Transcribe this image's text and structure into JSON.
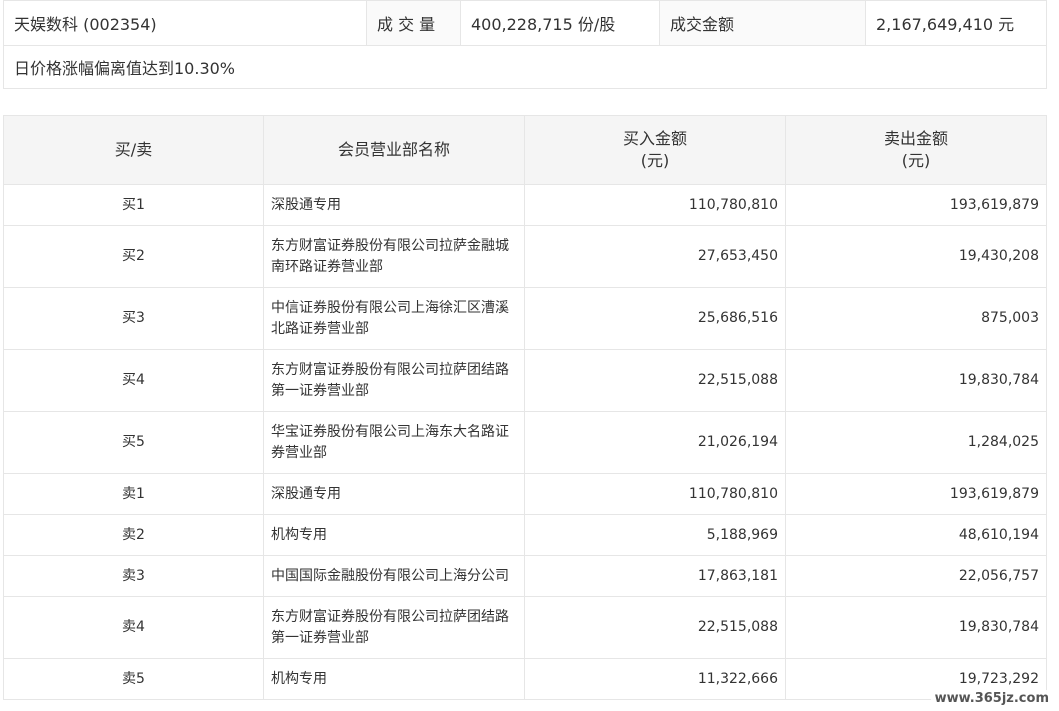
{
  "summary": {
    "stock": "天娱数科 (002354)",
    "volume_label": "成 交 量",
    "volume_value": "400,228,715 份/股",
    "amount_label": "成交金额",
    "amount_value": "2,167,649,410 元",
    "note": "日价格涨幅偏离值达到10.30%"
  },
  "table": {
    "headers": {
      "side": "买/卖",
      "name": "会员营业部名称",
      "buy_line1": "买入金额",
      "buy_line2": "(元)",
      "sell_line1": "卖出金额",
      "sell_line2": "(元)"
    },
    "rows": [
      {
        "side": "买1",
        "name_l1": "深股通专用",
        "name_l2": "",
        "buy": "110,780,810",
        "sell": "193,619,879"
      },
      {
        "side": "买2",
        "name_l1": "东方财富证券股份有限公司拉萨金融城",
        "name_l2": "南环路证券营业部",
        "buy": "27,653,450",
        "sell": "19,430,208"
      },
      {
        "side": "买3",
        "name_l1": "中信证券股份有限公司上海徐汇区漕溪",
        "name_l2": "北路证券营业部",
        "buy": "25,686,516",
        "sell": "875,003"
      },
      {
        "side": "买4",
        "name_l1": "东方财富证券股份有限公司拉萨团结路",
        "name_l2": "第一证券营业部",
        "buy": "22,515,088",
        "sell": "19,830,784"
      },
      {
        "side": "买5",
        "name_l1": "华宝证券股份有限公司上海东大名路证",
        "name_l2": "券营业部",
        "buy": "21,026,194",
        "sell": "1,284,025"
      },
      {
        "side": "卖1",
        "name_l1": "深股通专用",
        "name_l2": "",
        "buy": "110,780,810",
        "sell": "193,619,879"
      },
      {
        "side": "卖2",
        "name_l1": "机构专用",
        "name_l2": "",
        "buy": "5,188,969",
        "sell": "48,610,194"
      },
      {
        "side": "卖3",
        "name_l1": "中国国际金融股份有限公司上海分公司",
        "name_l2": "",
        "buy": "17,863,181",
        "sell": "22,056,757"
      },
      {
        "side": "卖4",
        "name_l1": "东方财富证券股份有限公司拉萨团结路",
        "name_l2": "第一证券营业部",
        "buy": "22,515,088",
        "sell": "19,830,784"
      },
      {
        "side": "卖5",
        "name_l1": "机构专用",
        "name_l2": "",
        "buy": "11,322,666",
        "sell": "19,723,292"
      }
    ]
  },
  "watermark": "www.365jz.com"
}
